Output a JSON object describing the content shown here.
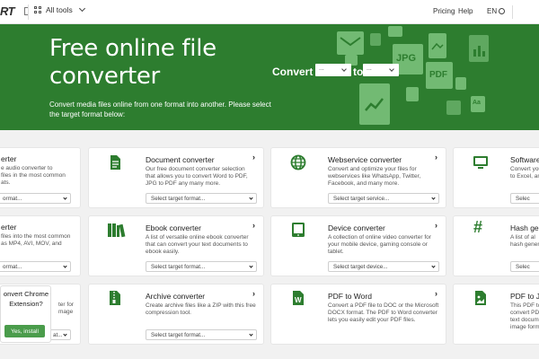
{
  "nav": {
    "logo": "RT",
    "all_tools": "All tools",
    "pricing": "Pricing",
    "help": "Help",
    "lang": "EN"
  },
  "hero": {
    "title_line1": "Free online file",
    "title_line2": "converter",
    "description": "Convert media files online from one format into another. Please select the target format below:",
    "convert_label": "Convert",
    "to_label": "to",
    "from_select": "...",
    "to_select": "...",
    "deco_jpg": "JPG",
    "deco_pdf": "PDF",
    "deco_aa": "Aa"
  },
  "cards": {
    "audio": {
      "title": "erter",
      "desc_1": "e audio converter to",
      "desc_2": "files in the most common",
      "desc_3": "ats.",
      "select": "ormat..."
    },
    "video": {
      "title": "erter",
      "desc_1": "files into the most common",
      "desc_2": "as MP4, AVI, MOV, and",
      "select": "ormat..."
    },
    "image": {
      "desc_1": "ter for",
      "desc_2": "mage",
      "select": "at..."
    },
    "document": {
      "title": "Document converter",
      "desc_1": "Our free document converter selection",
      "desc_2": "that allows you to convert Word to PDF,",
      "desc_3": "JPG to PDF any many more.",
      "select": "Select target format..."
    },
    "ebook": {
      "title": "Ebook converter",
      "desc_1": "A list of versatile online ebook converter",
      "desc_2": "that can convert your text documents to",
      "desc_3": "ebook easily.",
      "select": "Select target format..."
    },
    "archive": {
      "title": "Archive converter",
      "desc_1": "Create archive files like a ZIP with this free",
      "desc_2": "compression tool.",
      "select": "Select target format..."
    },
    "webservice": {
      "title": "Webservice converter",
      "desc_1": "Convert and optimize your files for",
      "desc_2": "webservices like WhatsApp, Twitter,",
      "desc_3": "Facebook, and many more.",
      "select": "Select target service..."
    },
    "device": {
      "title": "Device converter",
      "desc_1": "A collection of online video converter for",
      "desc_2": "your mobile device, gaming console or",
      "desc_3": "tablet.",
      "select": "Select target device..."
    },
    "pdf_word": {
      "title": "PDF to Word",
      "desc_1": "Convert a PDF file to DOC or the Microsoft",
      "desc_2": "DOCX format. The PDF to Word converter",
      "desc_3": "lets you easily edit your PDF files."
    },
    "software": {
      "title": "Software",
      "desc_1": "Convert you",
      "desc_2": "to Excel, an",
      "select": "Selec"
    },
    "hash": {
      "title": "Hash gen",
      "desc_1": "A list of al",
      "desc_2": "hash gener",
      "select": "Selec"
    },
    "pdf_jpg": {
      "title": "PDF to JP",
      "desc_1": "This PDF to",
      "desc_2": "convert PD",
      "desc_3": "text docum",
      "desc_4": "image form"
    }
  },
  "popup": {
    "line1": "onvert Chrome",
    "line2": "Extension?",
    "button": "Yes, install"
  },
  "colors": {
    "brand_green": "#2d7d2f",
    "button_green": "#4a9c4b",
    "light_green": "#72ba73"
  }
}
